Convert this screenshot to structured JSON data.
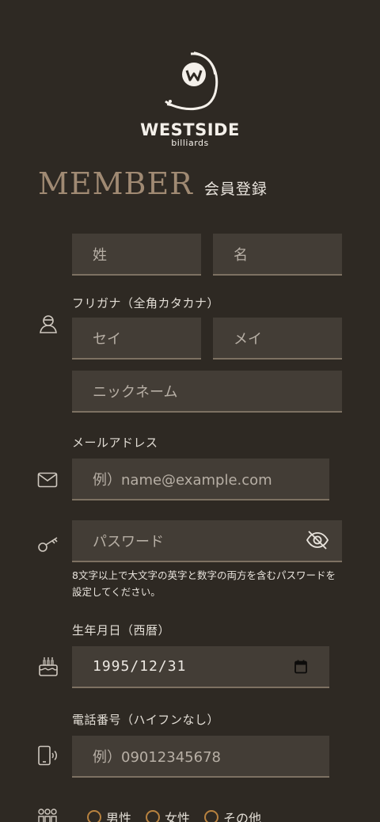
{
  "logo": {
    "title": "WESTSIDE",
    "subtitle": "billiards"
  },
  "heading": {
    "main": "MEMBER",
    "sub": "会員登録"
  },
  "name": {
    "last_placeholder": "姓",
    "first_placeholder": "名"
  },
  "furigana": {
    "label": "フリガナ（全角カタカナ）",
    "last_placeholder": "セイ",
    "first_placeholder": "メイ"
  },
  "nickname": {
    "placeholder": "ニックネーム"
  },
  "email": {
    "label": "メールアドレス",
    "placeholder": "例）name@example.com"
  },
  "password": {
    "placeholder": "パスワード",
    "hint": "8文字以上で大文字の英字と数字の両方を含むパスワードを設定してください。"
  },
  "birthday": {
    "label": "生年月日（西暦）",
    "value": "1995/12/31"
  },
  "phone": {
    "label": "電話番号（ハイフンなし）",
    "placeholder": "例）09012345678"
  },
  "gender": {
    "options": [
      "男性",
      "女性",
      "その他"
    ]
  },
  "colors": {
    "background": "#2e2923",
    "field": "#433d36",
    "accent": "#a08a73",
    "radio": "#b8823f"
  }
}
